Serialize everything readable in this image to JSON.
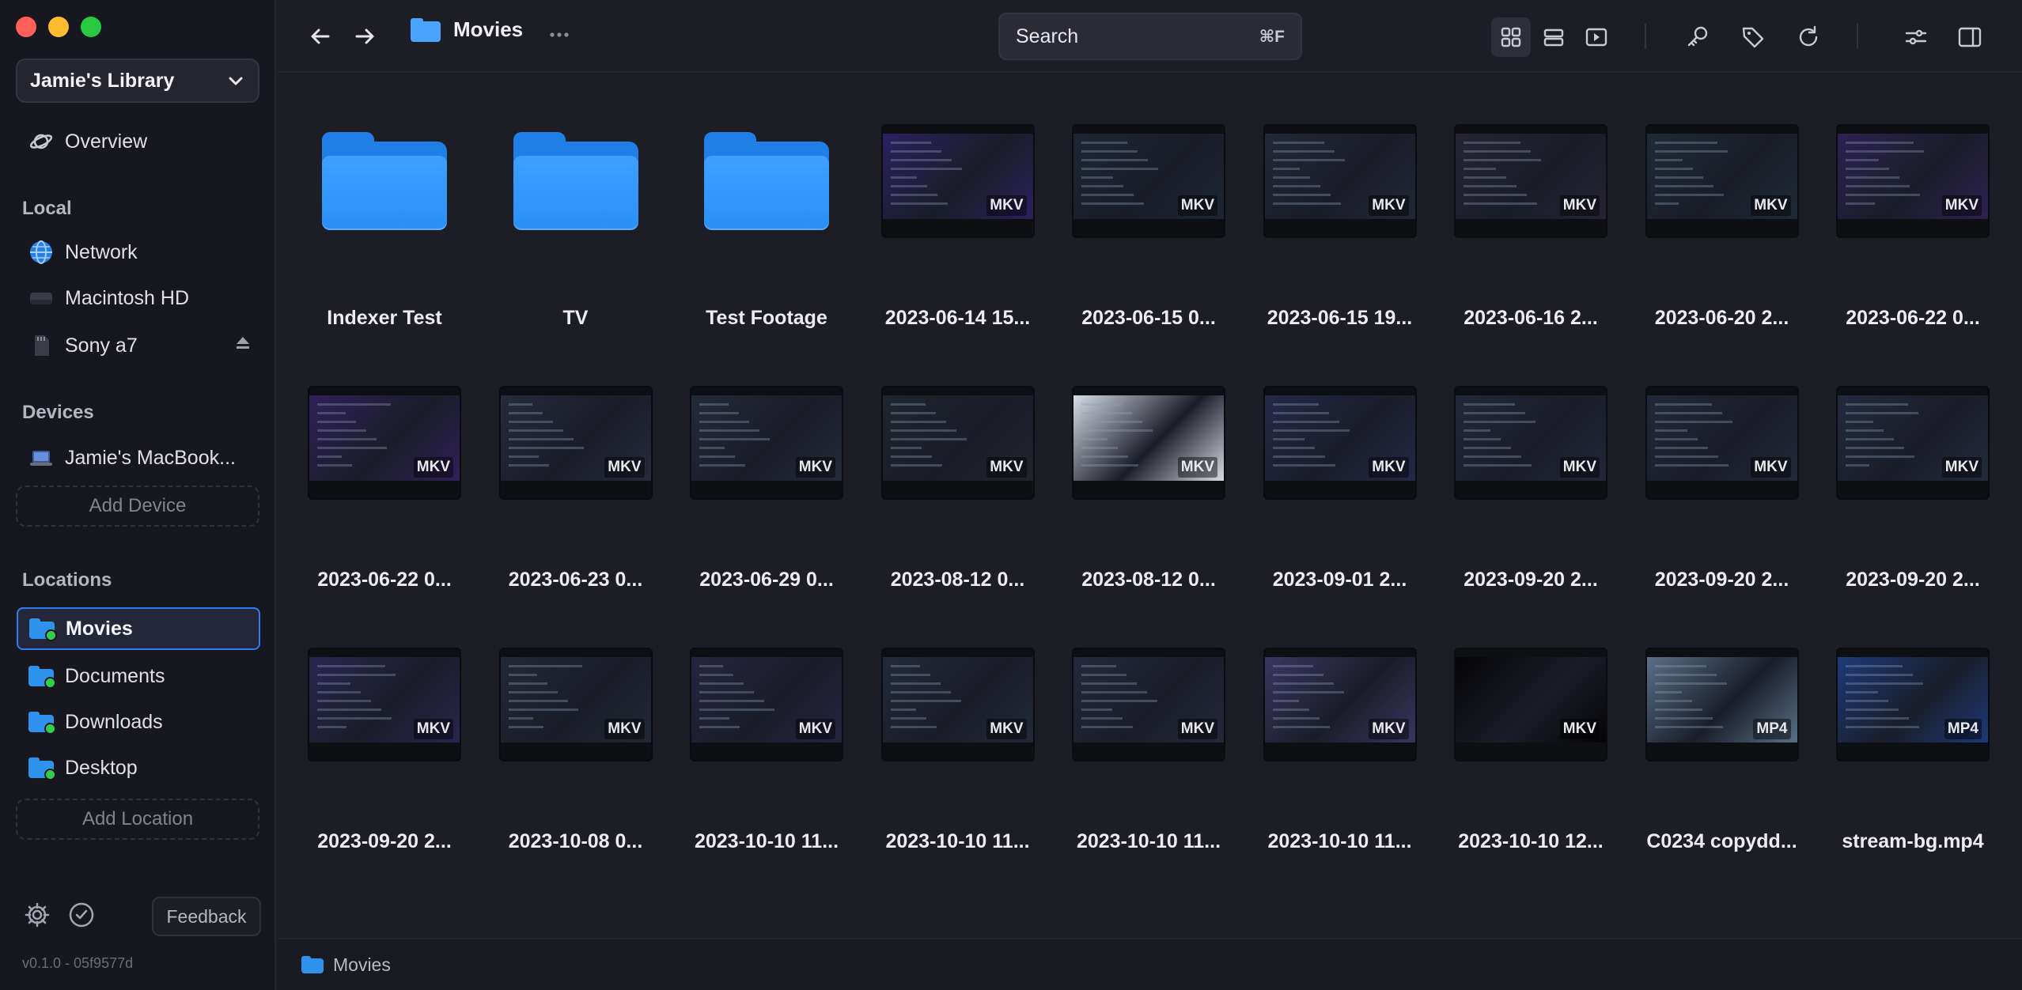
{
  "sidebar": {
    "library": "Jamie's Library",
    "overview": "Overview",
    "sections": {
      "local": "Local",
      "devices": "Devices",
      "locations": "Locations"
    },
    "local": [
      {
        "label": "Network",
        "icon": "globe-icon"
      },
      {
        "label": "Macintosh HD",
        "icon": "drive-icon"
      },
      {
        "label": "Sony a7",
        "icon": "sd-card-icon"
      }
    ],
    "devices": [
      {
        "label": "Jamie's MacBook...",
        "icon": "laptop-icon"
      }
    ],
    "add_device": "Add Device",
    "locations": [
      {
        "label": "Movies",
        "active": true
      },
      {
        "label": "Documents"
      },
      {
        "label": "Downloads"
      },
      {
        "label": "Desktop"
      }
    ],
    "add_location": "Add Location",
    "feedback": "Feedback",
    "version": "v0.1.0 - 05f9577d"
  },
  "topbar": {
    "crumb": "Movies",
    "search_label": "Search",
    "search_shortcut": "⌘F"
  },
  "items": [
    {
      "name": "Indexer Test",
      "kind": "folder"
    },
    {
      "name": "TV",
      "kind": "folder"
    },
    {
      "name": "Test Footage",
      "kind": "folder"
    },
    {
      "name": "2023-06-14 15...",
      "kind": "video",
      "badge": "MKV",
      "tint": "#2b2060"
    },
    {
      "name": "2023-06-15 0...",
      "kind": "video",
      "badge": "MKV",
      "tint": "#1e2532"
    },
    {
      "name": "2023-06-15 19...",
      "kind": "video",
      "badge": "MKV",
      "tint": "#232836"
    },
    {
      "name": "2023-06-16 2...",
      "kind": "video",
      "badge": "MKV",
      "tint": "#262433"
    },
    {
      "name": "2023-06-20 2...",
      "kind": "video",
      "badge": "MKV",
      "tint": "#1f2a34"
    },
    {
      "name": "2023-06-22 0...",
      "kind": "video",
      "badge": "MKV",
      "tint": "#2d2152"
    },
    {
      "name": "2023-06-22 0...",
      "kind": "video",
      "badge": "MKV",
      "tint": "#30205a"
    },
    {
      "name": "2023-06-23 0...",
      "kind": "video",
      "badge": "MKV",
      "tint": "#262a3a"
    },
    {
      "name": "2023-06-29 0...",
      "kind": "video",
      "badge": "MKV",
      "tint": "#252a38"
    },
    {
      "name": "2023-08-12 0...",
      "kind": "video",
      "badge": "MKV",
      "tint": "#20242c"
    },
    {
      "name": "2023-08-12 0...",
      "kind": "video",
      "badge": "MKV",
      "tint": "#d8dce4"
    },
    {
      "name": "2023-09-01 2...",
      "kind": "video",
      "badge": "MKV",
      "tint": "#252848"
    },
    {
      "name": "2023-09-20 2...",
      "kind": "video",
      "badge": "MKV",
      "tint": "#232738"
    },
    {
      "name": "2023-09-20 2...",
      "kind": "video",
      "badge": "MKV",
      "tint": "#232838"
    },
    {
      "name": "2023-09-20 2...",
      "kind": "video",
      "badge": "MKV",
      "tint": "#242a3c"
    },
    {
      "name": "2023-09-20 2...",
      "kind": "video",
      "badge": "MKV",
      "tint": "#2a2550"
    },
    {
      "name": "2023-10-08 0...",
      "kind": "video",
      "badge": "MKV",
      "tint": "#222834"
    },
    {
      "name": "2023-10-10 11...",
      "kind": "video",
      "badge": "MKV",
      "tint": "#262440"
    },
    {
      "name": "2023-10-10 11...",
      "kind": "video",
      "badge": "MKV",
      "tint": "#232937"
    },
    {
      "name": "2023-10-10 11...",
      "kind": "video",
      "badge": "MKV",
      "tint": "#24283a"
    },
    {
      "name": "2023-10-10 11...",
      "kind": "video",
      "badge": "MKV",
      "tint": "#3a3560"
    },
    {
      "name": "2023-10-10 12...",
      "kind": "video",
      "badge": "MKV",
      "tint": "#050507"
    },
    {
      "name": "C0234 copydd...",
      "kind": "video",
      "badge": "MP4",
      "tint": "#5a7088"
    },
    {
      "name": "stream-bg.mp4",
      "kind": "video",
      "badge": "MP4",
      "tint": "#1c3a7a"
    }
  ],
  "statusbar": {
    "path": "Movies"
  }
}
